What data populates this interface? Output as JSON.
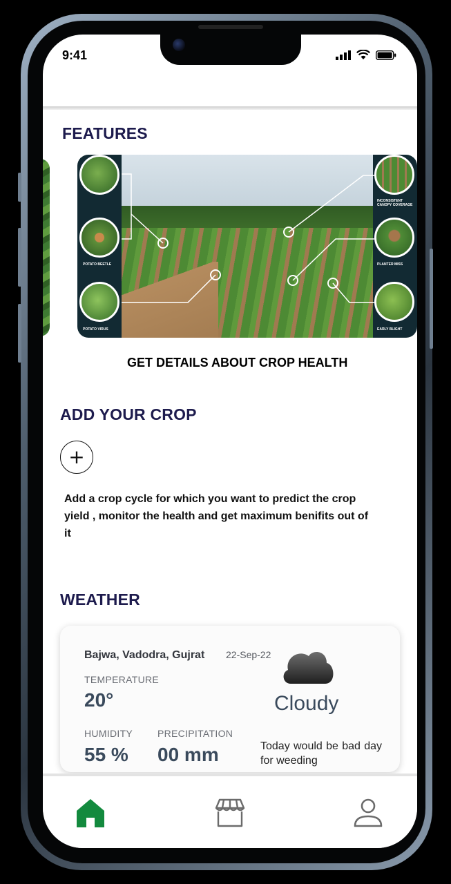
{
  "status_bar": {
    "time": "9:41"
  },
  "features": {
    "heading": "FEATURES",
    "caption": "GET DETAILS ABOUT CROP HEALTH",
    "left_labels": [
      "POTATO BEETLE",
      "POTATO VIRUS"
    ],
    "right_labels": [
      "INCONSISTENT CANOPY COVERAGE",
      "PLANTER MISS",
      "EARLY BLIGHT"
    ]
  },
  "add_crop": {
    "heading": "ADD YOUR CROP",
    "button_symbol": "+",
    "description": "Add a crop cycle for which you want to predict the crop yield , monitor the health  and get maximum benifits out of it"
  },
  "weather": {
    "heading": "WEATHER",
    "location": "Bajwa, Vadodra, Gujrat",
    "date": "22-Sep-22",
    "temperature_label": "TEMPERATURE",
    "temperature_value": "20°",
    "humidity_label": "HUMIDITY",
    "humidity_value": "55 %",
    "precipitation_label": "PRECIPITATION",
    "precipitation_value": "00 mm",
    "condition": "Cloudy",
    "condition_icon": "cloud-icon",
    "note": "Today would be bad day for weeding"
  },
  "bottom_nav": {
    "items": [
      {
        "icon": "home-icon",
        "active": true
      },
      {
        "icon": "store-icon",
        "active": false
      },
      {
        "icon": "profile-icon",
        "active": false
      }
    ],
    "active_color": "#138a3e",
    "inactive_color": "#6b6b6b"
  },
  "colors": {
    "heading": "#1d1b4d",
    "card_dark": "#122a33"
  }
}
